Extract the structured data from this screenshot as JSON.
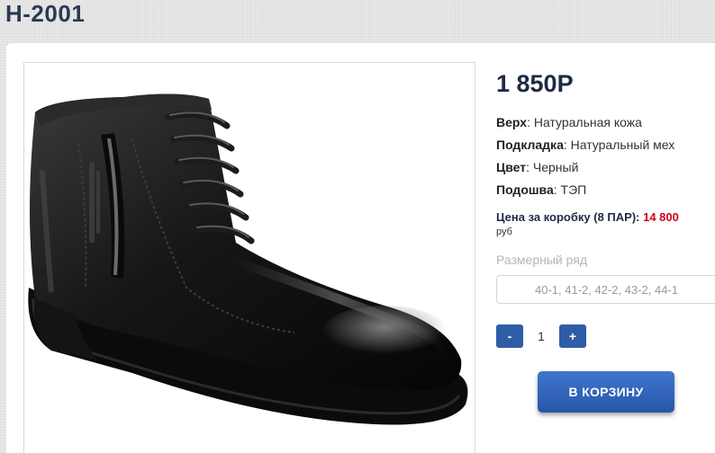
{
  "product": {
    "title": "Н-2001",
    "price": "1 850Р"
  },
  "specs": [
    {
      "label": "Верх",
      "value": ": Натуральная кожа"
    },
    {
      "label": "Подкладка",
      "value": ": Натуральный мех"
    },
    {
      "label": "Цвет",
      "value": ": Черный"
    },
    {
      "label": "Подошва",
      "value": ": ТЭП"
    }
  ],
  "box_price": {
    "label": "Цена за коробку (8 ПАР):",
    "value": "14 800",
    "unit": "руб"
  },
  "sizes": {
    "label": "Размерный ряд",
    "value": "40-1, 41-2, 42-2, 43-2, 44-1"
  },
  "quantity": {
    "minus_label": "-",
    "value": "1",
    "plus_label": "+"
  },
  "cart_button": {
    "label": "В КОРЗИНУ"
  },
  "colors": {
    "accent": "#2e5da8",
    "price_red": "#d0021b",
    "title": "#2b3a55"
  }
}
